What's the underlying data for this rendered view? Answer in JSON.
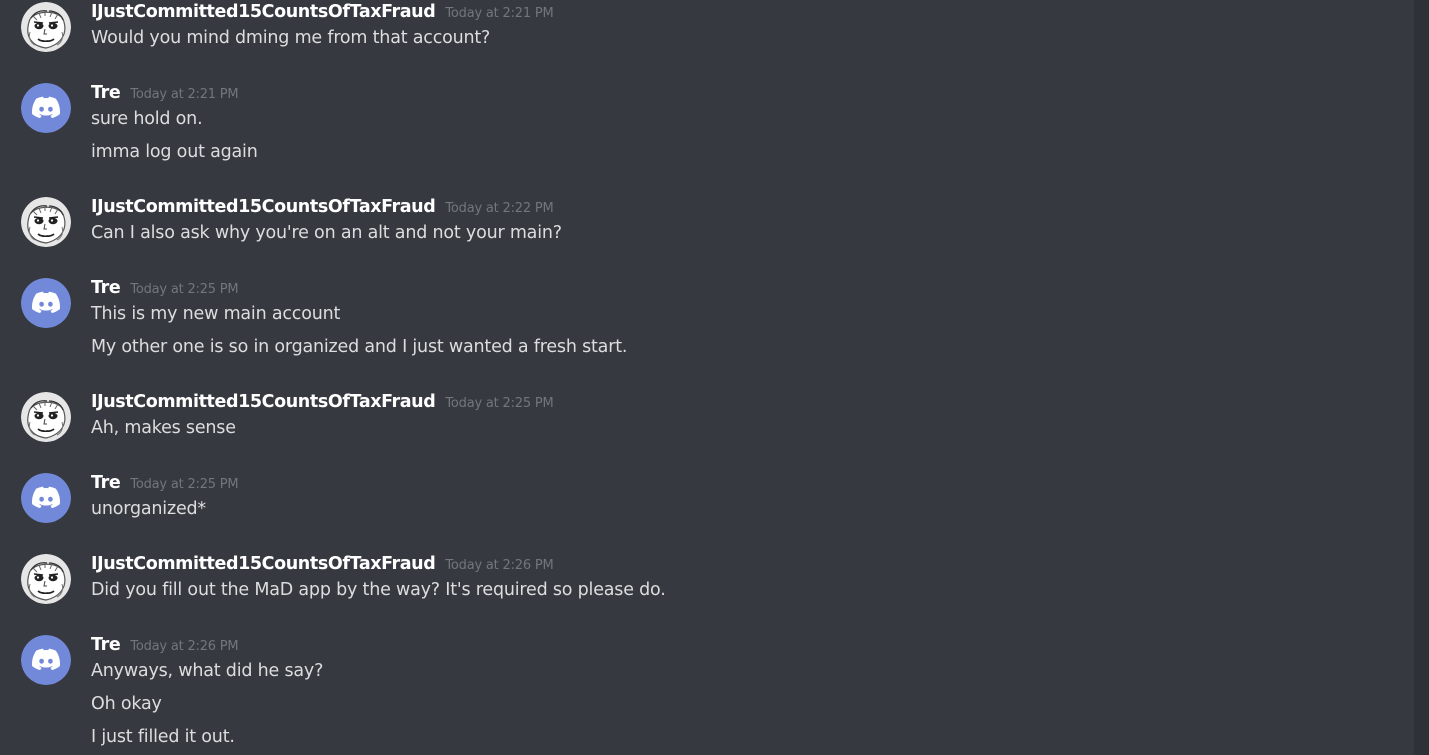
{
  "messages": [
    {
      "author": "IJustCommitted15CountsOfTaxFraud",
      "avatar": "sketch-face-avatar",
      "time": "Today at 2:21 PM",
      "lines": [
        "Would you mind dming me from that account?"
      ]
    },
    {
      "author": "Tre",
      "avatar": "discord-logo-avatar",
      "time": "Today at 2:21 PM",
      "lines": [
        "sure hold on.",
        "imma log out again"
      ]
    },
    {
      "author": "IJustCommitted15CountsOfTaxFraud",
      "avatar": "sketch-face-avatar",
      "time": "Today at 2:22 PM",
      "lines": [
        "Can I also ask why you're on an alt and not your main?"
      ]
    },
    {
      "author": "Tre",
      "avatar": "discord-logo-avatar",
      "time": "Today at 2:25 PM",
      "lines": [
        "This is my new main account",
        "My other one is so in organized and I just wanted a fresh start."
      ]
    },
    {
      "author": "IJustCommitted15CountsOfTaxFraud",
      "avatar": "sketch-face-avatar",
      "time": "Today at 2:25 PM",
      "lines": [
        "Ah, makes sense"
      ]
    },
    {
      "author": "Tre",
      "avatar": "discord-logo-avatar",
      "time": "Today at 2:25 PM",
      "lines": [
        "unorganized*"
      ]
    },
    {
      "author": "IJustCommitted15CountsOfTaxFraud",
      "avatar": "sketch-face-avatar",
      "time": "Today at 2:26 PM",
      "lines": [
        "Did you fill out the MaD app by the way? It's required so please do."
      ]
    },
    {
      "author": "Tre",
      "avatar": "discord-logo-avatar",
      "time": "Today at 2:26 PM",
      "lines": [
        "Anyways, what did he say?",
        "Oh okay",
        "I just filled it out."
      ]
    }
  ],
  "colors": {
    "background": "#36393f",
    "username": "#ffffff",
    "message_text": "#dcddde",
    "timestamp": "#72767d",
    "discord_blurple": "#7289da"
  }
}
